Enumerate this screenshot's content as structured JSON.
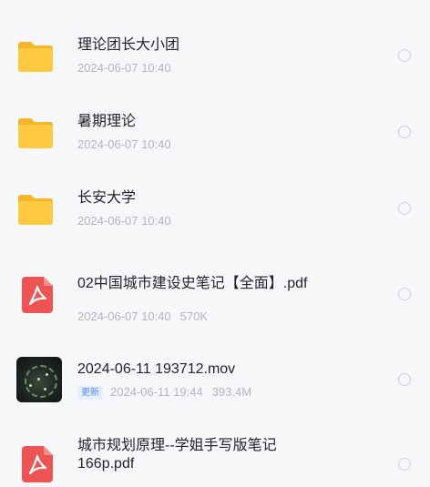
{
  "items": [
    {
      "title": "理论团长大小团",
      "date": "2024-06-07 10:40",
      "type": "folder",
      "icon": "folder-icon"
    },
    {
      "title": "暑期理论",
      "date": "2024-06-07 10:40",
      "type": "folder",
      "icon": "folder-icon"
    },
    {
      "title": "长安大学",
      "date": "2024-06-07 10:40",
      "type": "folder",
      "icon": "folder-icon"
    },
    {
      "title": "02中国城市建设史笔记【全面】.pdf",
      "date": "2024-06-07 10:40",
      "size": "570K",
      "type": "pdf",
      "icon": "pdf-icon"
    },
    {
      "title": "2024-06-11 193712.mov",
      "badge": "更新",
      "date": "2024-06-11 19:44",
      "size": "393.4M",
      "type": "video",
      "icon": "video-thumbnail"
    },
    {
      "title_line1": "城市规划原理--学姐手写版笔记",
      "title_line2": "166p.pdf",
      "type": "pdf",
      "icon": "pdf-icon"
    }
  ],
  "colors": {
    "folder": "#ffc940",
    "pdf": "#ef5454",
    "badge": "#4d8ff5"
  }
}
